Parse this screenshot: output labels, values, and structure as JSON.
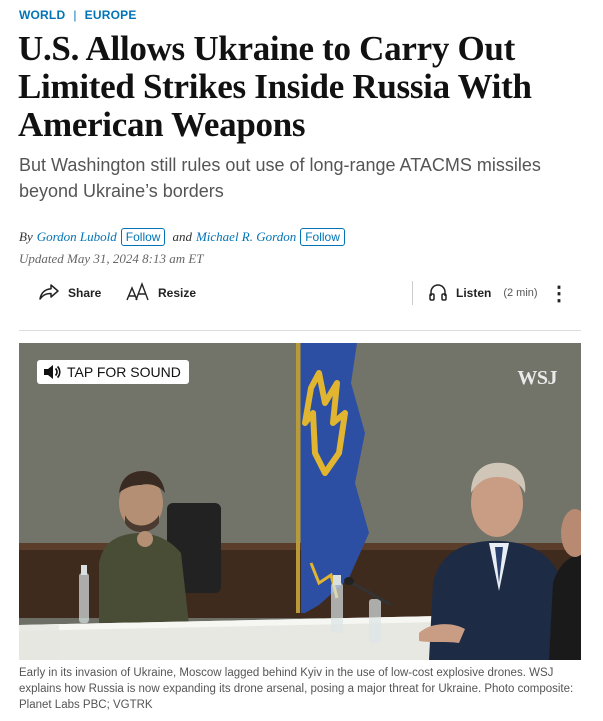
{
  "kicker": {
    "section": "WORLD",
    "separator": "|",
    "subsection": "EUROPE"
  },
  "headline": "U.S. Allows Ukraine to Carry Out Limited Strikes Inside Russia With American Weapons",
  "dek": "But Washington still rules out use of long-range ATACMS missiles beyond Ukraine’s borders",
  "byline": {
    "prefix": "By",
    "author1": "Gordon Lubold",
    "conjunction": "and",
    "author2": "Michael R. Gordon",
    "follow_label": "Follow"
  },
  "updated": "Updated May 31, 2024 8:13 am ET",
  "toolbar": {
    "share_label": "Share",
    "resize_label": "Resize",
    "listen_label": "Listen",
    "listen_duration": "(2 min)",
    "more_glyph": "⋮"
  },
  "video": {
    "tap_label": "TAP FOR SOUND",
    "watermark": "WSJ"
  },
  "caption": "Early in its invasion of Ukraine, Moscow lagged behind Kyiv in the use of low-cost explosive drones. WSJ explains how Russia is now expanding its drone arsenal, posing a major threat for Ukraine. Photo composite: Planet Labs PBC; VGTRK",
  "colors": {
    "link": "#0274b6",
    "text": "#111111",
    "muted": "#555555",
    "flag_blue": "#2d4fa3",
    "flag_gold": "#e1b530"
  }
}
